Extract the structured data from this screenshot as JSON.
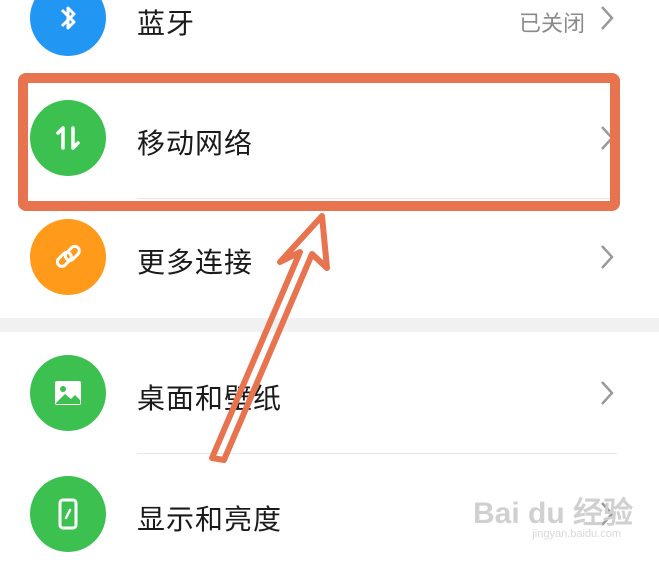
{
  "settings": {
    "items": [
      {
        "label": "蓝牙",
        "status": "已关闭",
        "icon": "bluetooth-icon",
        "color": "#2196f3"
      },
      {
        "label": "移动网络",
        "status": "",
        "icon": "mobile-data-icon",
        "color": "#3cc04f"
      },
      {
        "label": "更多连接",
        "status": "",
        "icon": "link-icon",
        "color": "#ff9a1a"
      },
      {
        "label": "桌面和壁纸",
        "status": "",
        "icon": "image-icon",
        "color": "#3cc04f"
      },
      {
        "label": "显示和亮度",
        "status": "",
        "icon": "phone-icon",
        "color": "#3cc04f"
      }
    ]
  },
  "annotation": {
    "highlight_color": "#e8734f"
  },
  "watermark": {
    "brand": "Bai du 经验",
    "url": "jingyan.baidu.com"
  }
}
